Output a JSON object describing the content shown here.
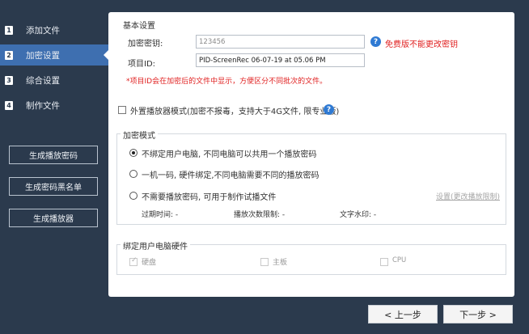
{
  "sidebar": {
    "items": [
      {
        "num": "1",
        "label": "添加文件"
      },
      {
        "num": "2",
        "label": "加密设置"
      },
      {
        "num": "3",
        "label": "综合设置"
      },
      {
        "num": "4",
        "label": "制作文件"
      }
    ],
    "active_index": 1,
    "buttons": {
      "gen_password": "生成播放密码",
      "gen_blacklist": "生成密码黑名单",
      "gen_player": "生成播放器"
    }
  },
  "basic": {
    "group_title": "基本设置",
    "key_label": "加密密钥:",
    "key_value": "123456",
    "key_note": "免费版不能更改密钥",
    "id_label": "项目ID:",
    "id_value": "PID-ScreenRec 06-07-19 at 05.06 PM",
    "id_note": "*项目ID会在加密后的文件中显示，方便区分不同批次的文件。"
  },
  "external_player": {
    "label": "外置播放器模式(加密不报毒，支持大于4G文件, 限专业版)",
    "checked": false
  },
  "encrypt_mode": {
    "group_title": "加密模式",
    "options": [
      {
        "label": "不绑定用户电脑, 不同电脑可以共用一个播放密码",
        "selected": true
      },
      {
        "label": "一机一码, 硬件绑定,不同电脑需要不同的播放密码",
        "selected": false
      },
      {
        "label": "不需要播放密码, 可用于制作试播文件",
        "selected": false
      }
    ],
    "settings_link": "设置(更改播放限制)",
    "expire_label": "过期时间: -",
    "count_label": "播放次数限制: -",
    "watermark_label": "文字水印: -"
  },
  "hardware": {
    "group_title": "绑定用户电脑硬件",
    "items": [
      {
        "label": "硬盘",
        "checked": true
      },
      {
        "label": "主板",
        "checked": false
      },
      {
        "label": "CPU",
        "checked": false
      }
    ]
  },
  "footer": {
    "prev": "< 上一步",
    "next": "下一步 >"
  },
  "colors": {
    "sidebar_bg": "#2b3a4d",
    "active_bg": "#3e6fb0",
    "note_red": "#e02020",
    "help_blue": "#2f7ad3"
  }
}
